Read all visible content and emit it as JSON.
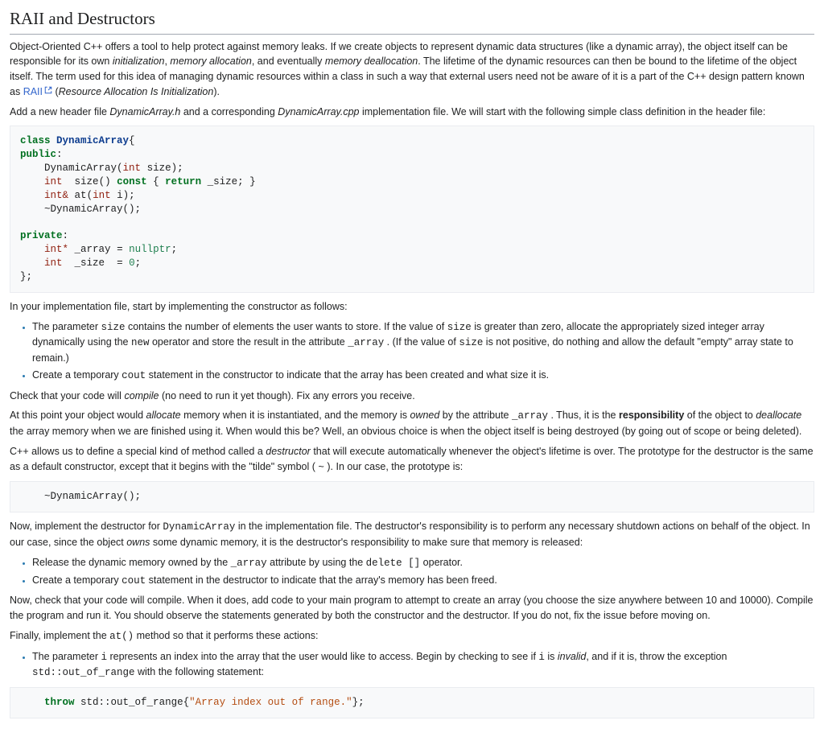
{
  "title": "RAII and Destructors",
  "intro": {
    "p1a": "Object-Oriented C++ offers a tool to help protect against memory leaks. If we create objects to represent dynamic data structures (like a dynamic array), the object itself can be responsible for its own ",
    "p1_init": "initialization",
    "p1_comma1": ", ",
    "p1_alloc": "memory allocation",
    "p1_mid": ", and eventually ",
    "p1_dealloc": "memory deallocation",
    "p1b": ". The lifetime of the dynamic resources can then be bound to the lifetime of the object itself. The term used for this idea of managing dynamic resources within a class in such a way that external users need not be aware of it is a part of the C++ design pattern known as ",
    "raii_link": "RAII",
    "p1c_open": " (",
    "p1c_res": "Resource Allocation Is Initialization",
    "p1c_close": ").",
    "p2a": "Add a new header file ",
    "p2_hfile": "DynamicArray.h",
    "p2_mid": " and a corresponding ",
    "p2_cfile": "DynamicArray.cpp",
    "p2b": " implementation file. We will start with the following simple class definition in the header file:"
  },
  "code1": {
    "kw_class": "class",
    "cls": "DynamicArray",
    "kw_public": "public",
    "ctor": "DynamicArray",
    "t_int": "int",
    "arg_size": "size",
    "fn_size": "size",
    "kw_const": "const",
    "kw_return": "return",
    "m_size": "_size",
    "t_intref": "int&",
    "fn_at": "at",
    "arg_i": "i",
    "dtor": "~DynamicArray",
    "kw_private": "private",
    "t_intptr": "int*",
    "m_array": "_array",
    "lit_null": "nullptr",
    "lit_zero": "0"
  },
  "impl_intro": "In your implementation file, start by implementing the constructor as follows:",
  "bullets1": {
    "b1a": "The parameter ",
    "b1_size": "size",
    "b1b": " contains the number of elements the user wants to store. If the value of ",
    "b1c": " is greater than zero, allocate the appropriately sized integer array dynamically using the ",
    "b1_new": "new",
    "b1d": " operator and store the result in the attribute ",
    "b1_array": "_array",
    "b1e": " . (If the value of ",
    "b1f": " is not positive, do nothing and allow the default \"empty\" array state to remain.)",
    "b2a": "Create a temporary ",
    "b2_cout": "cout",
    "b2b": " statement in the constructor to indicate that the array has been created and what size it is."
  },
  "p_compile1a": "Check that your code will ",
  "p_compile1_em": "compile",
  "p_compile1b": " (no need to run it yet though). Fix any errors you receive.",
  "p_allocate_a": "At this point your object would ",
  "p_alloc_em": "allocate",
  "p_allocate_b": " memory when it is instantiated, and the memory is ",
  "p_owned_em": "owned",
  "p_allocate_c": " by the attribute ",
  "p_allocate_arr": "_array",
  "p_allocate_d": " . Thus, it is the ",
  "p_resp": "responsibility",
  "p_allocate_e": " of the object to ",
  "p_dealloc_em": "deallocate",
  "p_allocate_f": " the array memory when we are finished using it. When would this be? Well, an obvious choice is when the object itself is being destroyed (by going out of scope or being deleted).",
  "p_dtor_a": "C++ allows us to define a special kind of method called a ",
  "p_dtor_em": "destructor",
  "p_dtor_b": " that will execute automatically whenever the object's lifetime is over. The prototype for the destructor is the same as a default constructor, except that it begins with the \"tilde\" symbol ( ",
  "p_tilde": "~",
  "p_dtor_c": " ). In our case, the prototype is:",
  "code2": "~DynamicArray();",
  "p_impl_dtor_a": "Now, implement the destructor for ",
  "p_impl_dtor_cls": "DynamicArray",
  "p_impl_dtor_b": " in the implementation file. The destructor's responsibility is to perform any necessary shutdown actions on behalf of the object. In our case, since the object ",
  "p_owns_em": "owns",
  "p_impl_dtor_c": " some dynamic memory, it is the destructor's responsibility to make sure that memory is released:",
  "bullets2": {
    "b1a": "Release the dynamic memory owned by the ",
    "b1_arr": "_array",
    "b1b": " attribute by using the ",
    "b1_del": "delete []",
    "b1c": " operator.",
    "b2a": "Create a temporary ",
    "b2_cout": "cout",
    "b2b": " statement in the destructor to indicate that the array's memory has been freed."
  },
  "p_compile2": "Now, check that your code will compile. When it does, add code to your main program to attempt to create an array (you choose the size anywhere between 10 and 10000). Compile the program and run it. You should observe the statements generated by both the constructor and the destructor. If you do not, fix the issue before moving on.",
  "p_at_a": "Finally, implement the ",
  "p_at_fn": "at()",
  "p_at_b": " method so that it performs these actions:",
  "bullets3": {
    "b1a": "The parameter ",
    "b1_i": "i",
    "b1b": " represents an index into the array that the user would like to access. Begin by checking to see if ",
    "b1c": " is ",
    "b1_invalid": "invalid",
    "b1d": ", and if it is, throw the exception ",
    "b1_ex": "std::out_of_range",
    "b1e": " with the following statement:"
  },
  "code3": {
    "kw_throw": "throw",
    "exc": "std::out_of_range",
    "str": "\"Array index out of range.\""
  }
}
